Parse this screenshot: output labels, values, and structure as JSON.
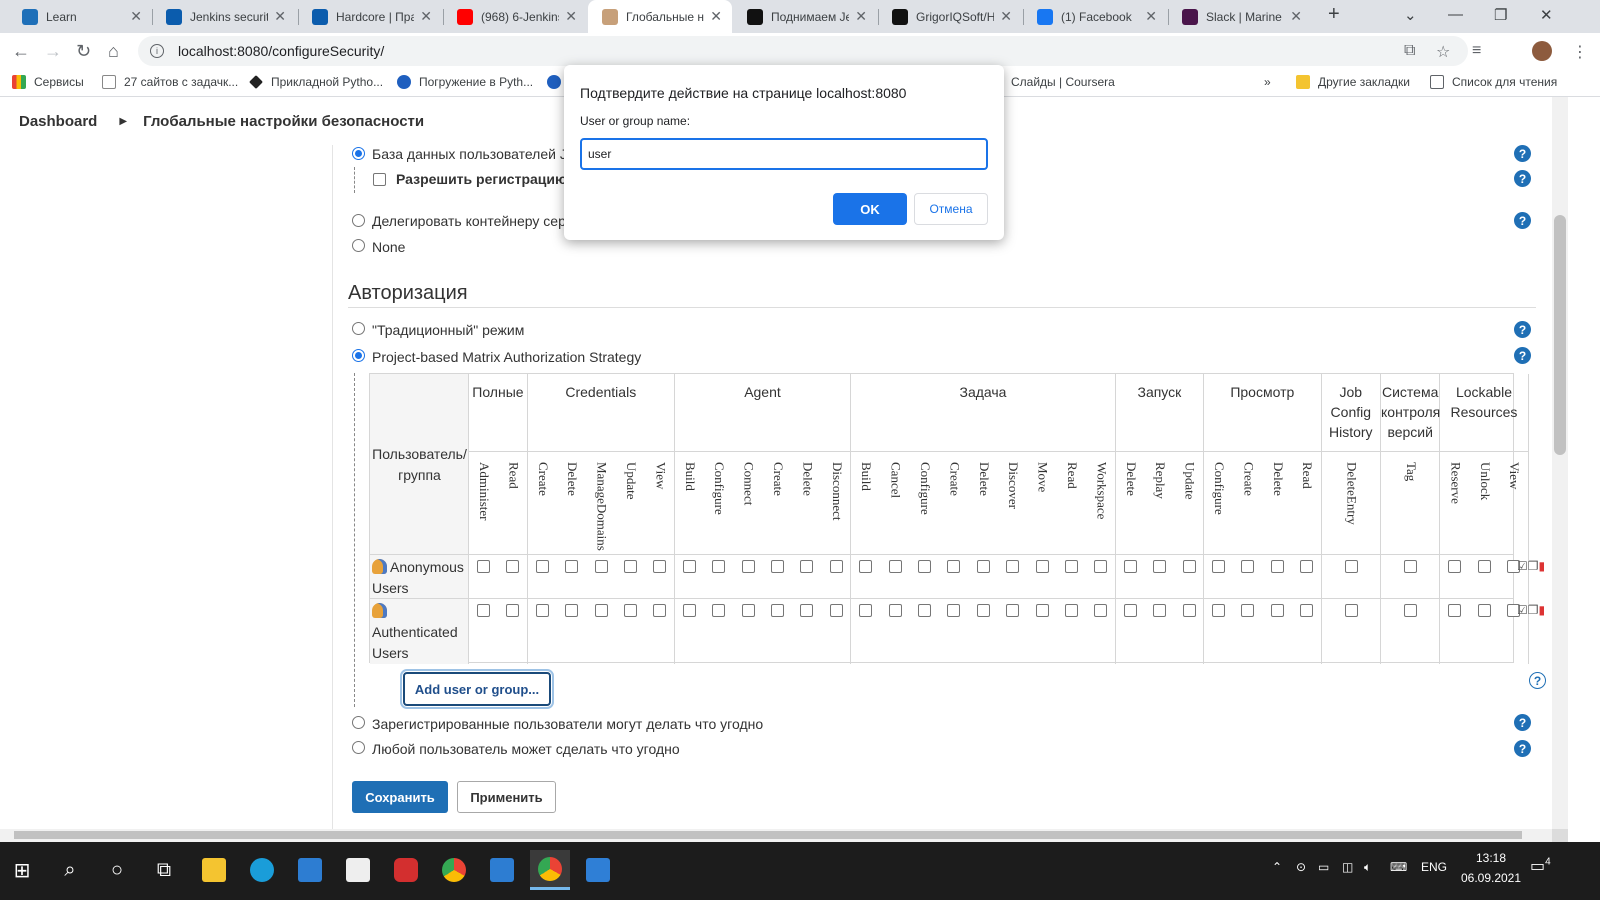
{
  "browser": {
    "tabs": [
      {
        "title": "Learn",
        "color": "#1e6fb8",
        "icon": "book-icon"
      },
      {
        "title": "Jenkins security",
        "color": "#0b5cad",
        "icon": "circle-o-icon"
      },
      {
        "title": "Hardcore | Прак",
        "color": "#0b5cad",
        "icon": "circle-o-icon"
      },
      {
        "title": "(968) 6-Jenkins",
        "color": "#ff0000",
        "icon": "youtube-icon"
      },
      {
        "title": "Глобальные на",
        "color": "#c7a07a",
        "icon": "jenkins-icon"
      },
      {
        "title": "Поднимаем Jen",
        "color": "#111111",
        "icon": "amazon-a-icon"
      },
      {
        "title": "GrigorIQSoft/H",
        "color": "#111111",
        "icon": "github-icon"
      },
      {
        "title": "(1) Facebook",
        "color": "#1877f2",
        "icon": "facebook-icon"
      },
      {
        "title": "Slack | Marine Y",
        "color": "#4a154b",
        "icon": "slack-icon"
      }
    ],
    "url": "localhost:8080/configureSecurity/",
    "bookmarks": [
      {
        "label": "Сервисы",
        "color": "#ea4335"
      },
      {
        "label": "27 сайтов с задачк...",
        "color": "#ffffff"
      },
      {
        "label": "Прикладной Pytho...",
        "color": "#222222"
      },
      {
        "label": "Погружение в Pyth...",
        "color": "#1f5fbf"
      },
      {
        "label": "Слайды | Coursera",
        "color": "#ffffff"
      },
      {
        "label": "Другие закладки",
        "color": "#f4c430"
      },
      {
        "label": "Список для чтения",
        "color": "#ffffff"
      }
    ]
  },
  "breadcrumb": {
    "home": "Dashboard",
    "current": "Глобальные настройки безопасности"
  },
  "security_realm": {
    "option_jenkins_db": "База данных пользователей Jenkins",
    "allow_signup": "Разрешить регистрацию пользователей",
    "option_delegate": "Делегировать контейнеру сервлетов",
    "option_none": "None"
  },
  "authorization": {
    "heading": "Авторизация",
    "option_legacy": "\"Традиционный\" режим",
    "option_matrix": "Project-based Matrix Authorization Strategy",
    "option_logged_in": "Зарегистрированные пользователи могут делать что угодно",
    "option_anyone": "Любой пользователь может сделать что угодно"
  },
  "matrix": {
    "user_header": "Пользователь/ группа",
    "groups": [
      {
        "label": "Полные",
        "perms": [
          "Administer",
          "Read"
        ]
      },
      {
        "label": "Credentials",
        "perms": [
          "Create",
          "Delete",
          "ManageDomains",
          "Update",
          "View"
        ]
      },
      {
        "label": "Agent",
        "perms": [
          "Build",
          "Configure",
          "Connect",
          "Create",
          "Delete",
          "Disconnect"
        ]
      },
      {
        "label": "Задача",
        "perms": [
          "Build",
          "Cancel",
          "Configure",
          "Create",
          "Delete",
          "Discover",
          "Move",
          "Read",
          "Workspace"
        ]
      },
      {
        "label": "Запуск",
        "perms": [
          "Delete",
          "Replay",
          "Update"
        ]
      },
      {
        "label": "Просмотр",
        "perms": [
          "Configure",
          "Create",
          "Delete",
          "Read"
        ]
      },
      {
        "label": "Job Config History",
        "perms": [
          "DeleteEntry"
        ]
      },
      {
        "label": "Система контроля версий",
        "perms": [
          "Tag"
        ]
      },
      {
        "label": "Lockable Resources",
        "perms": [
          "Reserve",
          "Unlock",
          "View"
        ]
      }
    ],
    "rows": [
      {
        "name": "Anonymous Users"
      },
      {
        "name": "Authenticated Users"
      }
    ],
    "add_button": "Add user or group..."
  },
  "buttons": {
    "save": "Сохранить",
    "apply": "Применить"
  },
  "dialog": {
    "title": "Подтвердите действие на странице localhost:8080",
    "label": "User or group name:",
    "value": "user",
    "ok": "OK",
    "cancel": "Отмена"
  },
  "taskbar": {
    "lang": "ENG",
    "time": "13:18",
    "date": "06.09.2021",
    "notifications": "4"
  }
}
